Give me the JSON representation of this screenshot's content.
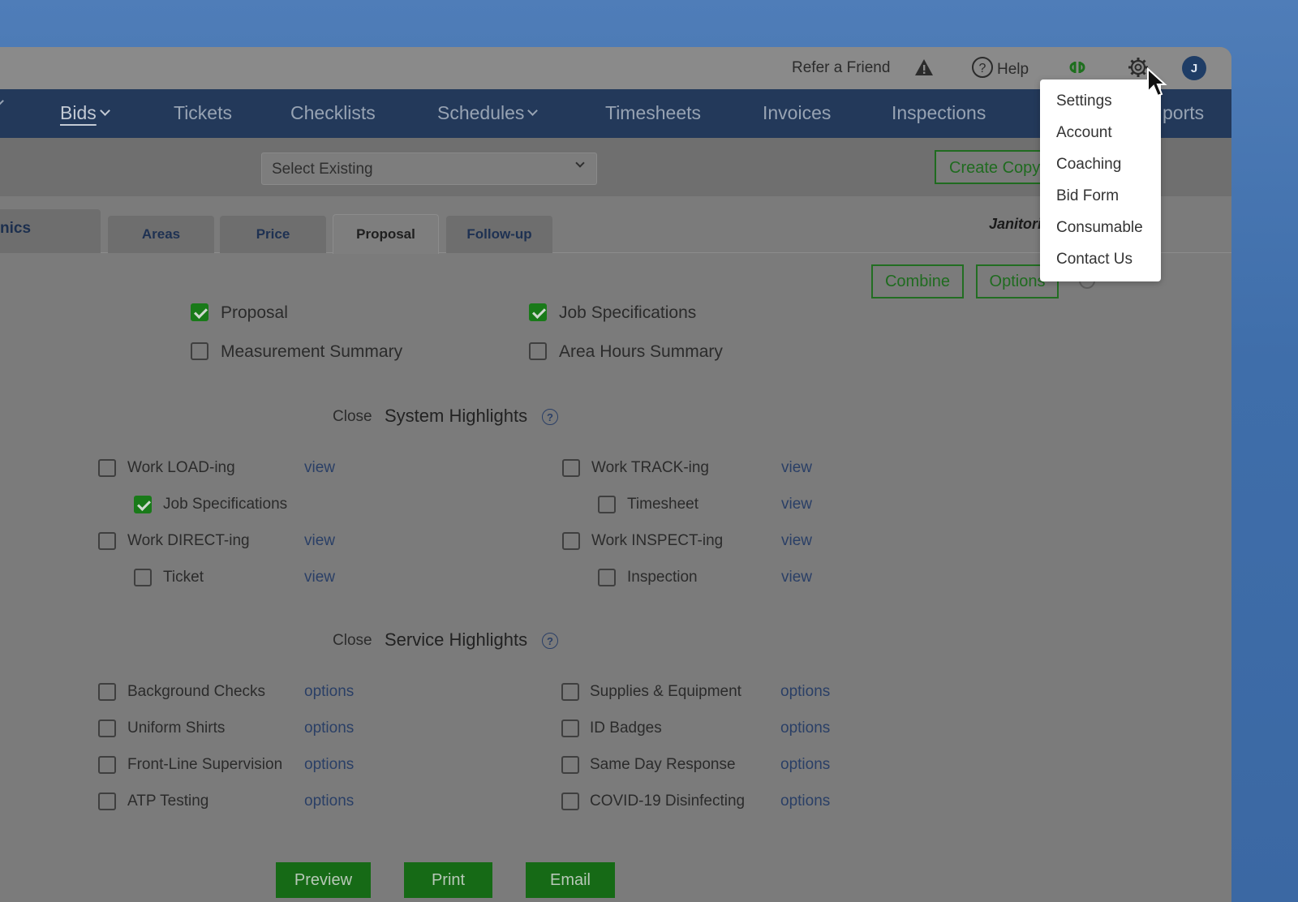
{
  "topbar": {
    "refer": "Refer a Friend",
    "help": "Help",
    "avatar_initial": "J"
  },
  "nav": {
    "items": [
      {
        "label": "Bids"
      },
      {
        "label": "Tickets"
      },
      {
        "label": "Checklists"
      },
      {
        "label": "Schedules"
      },
      {
        "label": "Timesheets"
      },
      {
        "label": "Invoices"
      },
      {
        "label": "Inspections"
      },
      {
        "label": "ports"
      }
    ]
  },
  "toolbar": {
    "select_value": "Select Existing",
    "create_label": "Create Copy"
  },
  "tabs": {
    "left_partial": "nics",
    "items": [
      {
        "label": "Areas"
      },
      {
        "label": "Price"
      },
      {
        "label": "Proposal"
      },
      {
        "label": "Follow-up"
      }
    ],
    "janitor": "Janitorial"
  },
  "actions": {
    "combine": "Combine",
    "options": "Options"
  },
  "documents": [
    {
      "label": "Proposal",
      "checked": true
    },
    {
      "label": "Job Specifications",
      "checked": true
    },
    {
      "label": "Measurement Summary",
      "checked": false
    },
    {
      "label": "Area Hours Summary",
      "checked": false
    }
  ],
  "system": {
    "close": "Close",
    "title": "System Highlights",
    "items": [
      {
        "label": "Work LOAD-ing",
        "link": "view",
        "checked": false
      },
      {
        "label": "Job Specifications",
        "link": "",
        "checked": true
      },
      {
        "label": "Work DIRECT-ing",
        "link": "view",
        "checked": false
      },
      {
        "label": "Ticket",
        "link": "view",
        "checked": false
      },
      {
        "label": "Work TRACK-ing",
        "link": "view",
        "checked": false
      },
      {
        "label": "Timesheet",
        "link": "view",
        "checked": false
      },
      {
        "label": "Work INSPECT-ing",
        "link": "view",
        "checked": false
      },
      {
        "label": "Inspection",
        "link": "view",
        "checked": false
      }
    ]
  },
  "service": {
    "close": "Close",
    "title": "Service Highlights",
    "items": [
      {
        "label": "Background Checks",
        "link": "options"
      },
      {
        "label": "Uniform Shirts",
        "link": "options"
      },
      {
        "label": "Front-Line Supervision",
        "link": "options"
      },
      {
        "label": "ATP Testing",
        "link": "options"
      },
      {
        "label": "Supplies & Equipment",
        "link": "options"
      },
      {
        "label": "ID Badges",
        "link": "options"
      },
      {
        "label": "Same Day Response",
        "link": "options"
      },
      {
        "label": "COVID-19 Disinfecting",
        "link": "options"
      }
    ]
  },
  "bottom": {
    "preview": "Preview",
    "print": "Print",
    "email": "Email"
  },
  "menu": {
    "items": [
      {
        "label": "Settings"
      },
      {
        "label": "Account"
      },
      {
        "label": "Coaching"
      },
      {
        "label": "Bid Form"
      },
      {
        "label": "Consumable"
      },
      {
        "label": "Contact Us"
      }
    ]
  },
  "colors": {
    "nav": "#23395a",
    "accent_green": "#166a16",
    "overlay": "#7b7b7b"
  }
}
